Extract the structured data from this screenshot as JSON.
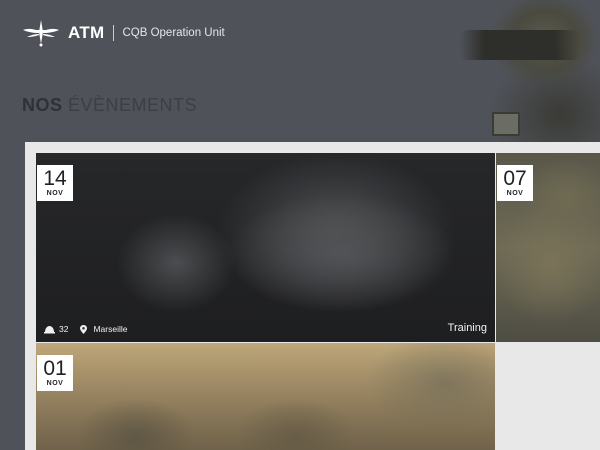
{
  "header": {
    "brand": "ATM",
    "unit": "CQB Operation Unit",
    "logo_icon": "winged-dagger-icon"
  },
  "section": {
    "title_bold": "NOS",
    "title_light": "ÉVÈNEMENTS"
  },
  "events": [
    {
      "day": "14",
      "month": "NOV",
      "participants": "32",
      "location": "Marseille",
      "category": "Training",
      "participants_icon": "helmet-icon",
      "location_icon": "map-pin-icon"
    },
    {
      "day": "07",
      "month": "NOV"
    },
    {
      "day": "01",
      "month": "NOV"
    }
  ],
  "colors": {
    "background": "#4f5259",
    "board": "#e8e8e8",
    "badge": "#ffffff",
    "title": "#2f3136"
  }
}
